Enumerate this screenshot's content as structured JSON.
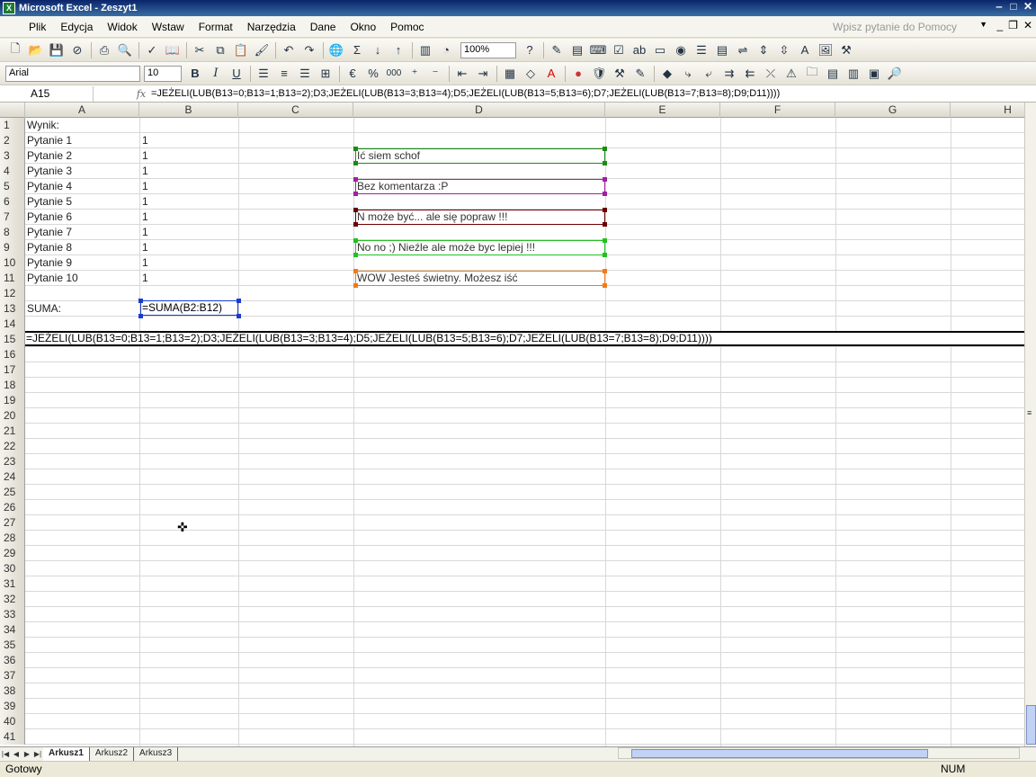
{
  "window": {
    "title": "Microsoft Excel - Zeszyt1",
    "app_icon": "X"
  },
  "menu": {
    "items": [
      "Plik",
      "Edycja",
      "Widok",
      "Wstaw",
      "Format",
      "Narzędzia",
      "Dane",
      "Okno",
      "Pomoc"
    ],
    "help_placeholder": "Wpisz pytanie do Pomocy"
  },
  "toolbar": {
    "zoom": "100%",
    "font_name": "Arial",
    "font_size": "10",
    "bold": "B",
    "italic": "I",
    "underline": "U",
    "percent": "%",
    "thousands": "000"
  },
  "formula_bar": {
    "name_box": "A15",
    "fx": "fx",
    "formula": "=JEŻELI(LUB(B13=0;B13=1;B13=2);D3;JEŻELI(LUB(B13=3;B13=4);D5;JEŻELI(LUB(B13=5;B13=6);D7;JEŻELI(LUB(B13=7;B13=8);D9;D11))))"
  },
  "columns": [
    "A",
    "B",
    "C",
    "D",
    "E",
    "F",
    "G",
    "H"
  ],
  "rows": [
    {
      "n": "1",
      "a": "Wynik:",
      "b": ""
    },
    {
      "n": "2",
      "a": "Pytanie 1",
      "b": "1"
    },
    {
      "n": "3",
      "a": "Pytanie 2",
      "b": "1"
    },
    {
      "n": "4",
      "a": "Pytanie 3",
      "b": "1"
    },
    {
      "n": "5",
      "a": "Pytanie 4",
      "b": "1"
    },
    {
      "n": "6",
      "a": "Pytanie 5",
      "b": "1"
    },
    {
      "n": "7",
      "a": "Pytanie 6",
      "b": "1"
    },
    {
      "n": "8",
      "a": "Pytanie 7",
      "b": "1"
    },
    {
      "n": "9",
      "a": "Pytanie 8",
      "b": "1"
    },
    {
      "n": "10",
      "a": "Pytanie 9",
      "b": "1"
    },
    {
      "n": "11",
      "a": "Pytanie 10",
      "b": "1"
    },
    {
      "n": "12",
      "a": "",
      "b": ""
    },
    {
      "n": "13",
      "a": "SUMA:",
      "b": ""
    },
    {
      "n": "14",
      "a": "",
      "b": ""
    },
    {
      "n": "15",
      "a": "",
      "b": ""
    },
    {
      "n": "16"
    },
    {
      "n": "17"
    },
    {
      "n": "18"
    },
    {
      "n": "19"
    },
    {
      "n": "20"
    },
    {
      "n": "21"
    },
    {
      "n": "22"
    },
    {
      "n": "23"
    },
    {
      "n": "24"
    },
    {
      "n": "25"
    },
    {
      "n": "26"
    },
    {
      "n": "27"
    },
    {
      "n": "28"
    },
    {
      "n": "29"
    },
    {
      "n": "30"
    },
    {
      "n": "31"
    },
    {
      "n": "32"
    },
    {
      "n": "33"
    },
    {
      "n": "34"
    },
    {
      "n": "35"
    },
    {
      "n": "36"
    },
    {
      "n": "37"
    },
    {
      "n": "38"
    },
    {
      "n": "39"
    },
    {
      "n": "40"
    },
    {
      "n": "41"
    }
  ],
  "b13_formula": "=SUMA(B2:B12)",
  "row15_formula": "=JEŻELI(LUB(B13=0;B13=1;B13=2);D3;JEŻELI(LUB(B13=3;B13=4);D5;JEŻELI(LUB(B13=5;B13=6);D7;JEŻELI(LUB(B13=7;B13=8);D9;D11))))",
  "textboxes": [
    {
      "row": 3,
      "text": "Ić siem schof",
      "color": "#1a8a1a"
    },
    {
      "row": 5,
      "text": "Bez komentarza :P",
      "color": "#a020a0"
    },
    {
      "row": 7,
      "text": "N może być... ale się popraw !!!",
      "color": "#6b0000"
    },
    {
      "row": 9,
      "text": "No no ;) Nieźle ale może byc lepiej !!!",
      "color": "#22c022"
    },
    {
      "row": 11,
      "text": "WOW Jesteś świetny. Możesz iść",
      "color": "#f07a1a"
    }
  ],
  "sheets": [
    "Arkusz1",
    "Arkusz2",
    "Arkusz3"
  ],
  "active_sheet": "Arkusz1",
  "status": {
    "left": "Gotowy",
    "num": "NUM"
  }
}
